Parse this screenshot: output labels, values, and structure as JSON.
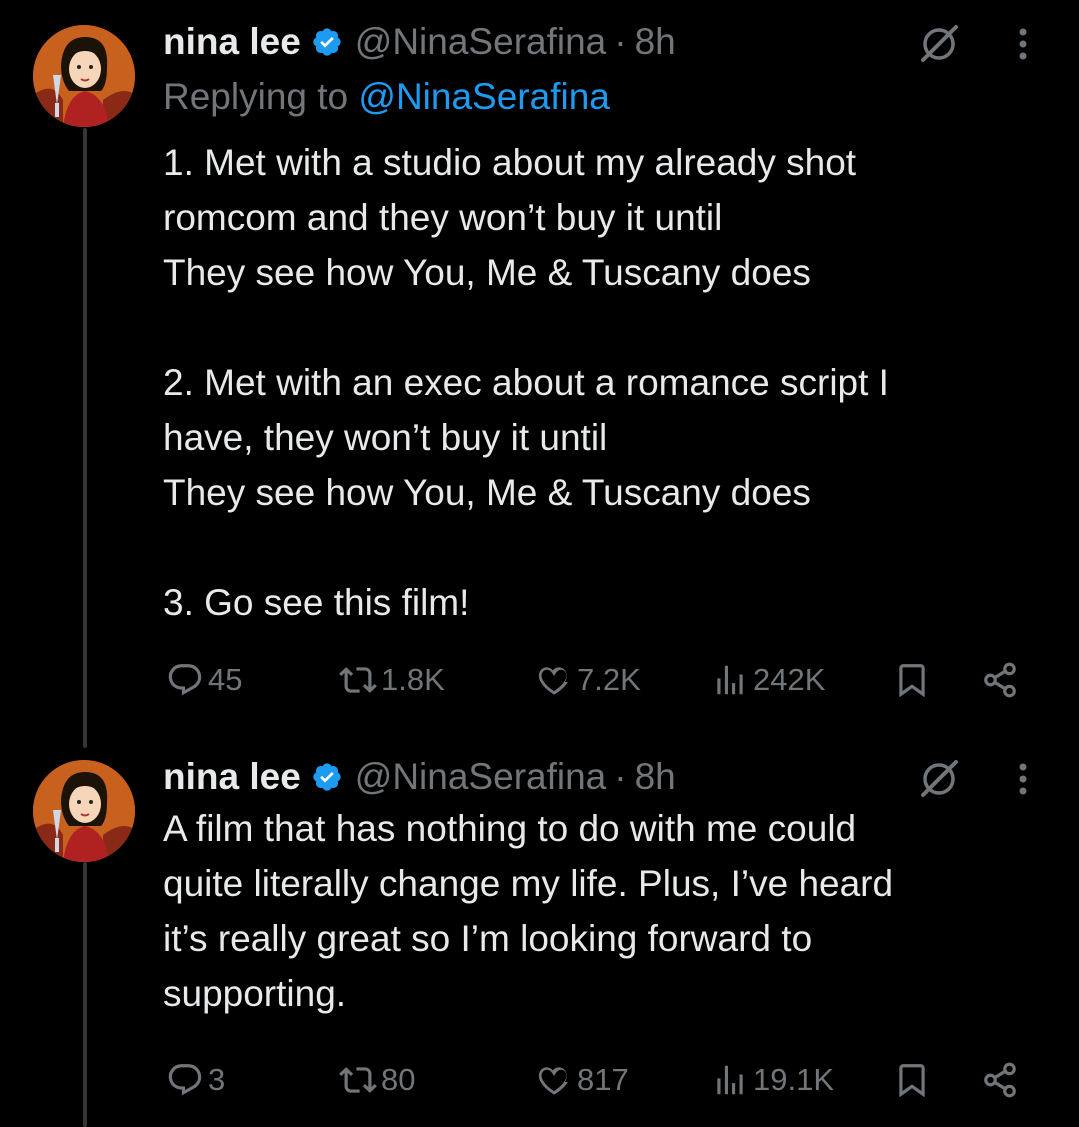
{
  "tweets": [
    {
      "author": {
        "name": "nina lee",
        "handle": "@NinaSerafina",
        "time": "8h"
      },
      "replying_label": "Replying to",
      "replying_to": "@NinaSerafina",
      "text": "1. Met with a studio about my already shot\nromcom and they won’t buy it until\nThey see how You, Me & Tuscany does\n\n2. Met with an exec about a romance script I\nhave, they won’t buy it until\nThey see how You, Me & Tuscany does\n\n3. Go see this film!",
      "stats": {
        "replies": "45",
        "reposts": "1.8K",
        "likes": "7.2K",
        "views": "242K"
      }
    },
    {
      "author": {
        "name": "nina lee",
        "handle": "@NinaSerafina",
        "time": "8h"
      },
      "text": "A film that has nothing to do with me could\nquite literally change my life. Plus, I’ve heard\nit’s really great so I’m looking forward to\nsupporting.",
      "stats": {
        "replies": "3",
        "reposts": "80",
        "likes": "817",
        "views": "19.1K"
      }
    }
  ],
  "separator": "·",
  "colors": {
    "background": "#000000",
    "text": "#e7e9ea",
    "secondary": "#71767b",
    "accent": "#1d9bf0",
    "thread_line": "#333639"
  },
  "icons": [
    "verified-badge-icon",
    "grok-icon",
    "more-icon",
    "reply-icon",
    "repost-icon",
    "like-icon",
    "views-icon",
    "bookmark-icon",
    "share-icon"
  ]
}
